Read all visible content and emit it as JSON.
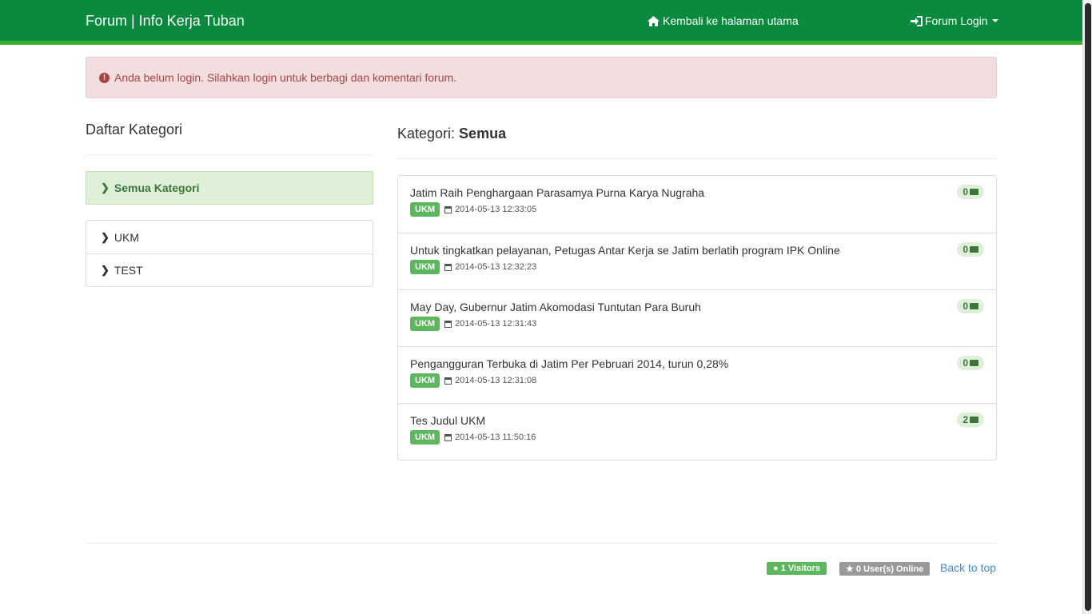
{
  "navbar": {
    "brand": "Forum | Info Kerja Tuban",
    "home_label": "Kembali ke halaman utama",
    "login_label": "Forum Login"
  },
  "alert": {
    "message": "Anda belum login. Silahkan login untuk berbagi dan komentari forum."
  },
  "sidebar": {
    "title": "Daftar Kategori",
    "active": "Semua Kategori",
    "items": [
      {
        "label": "UKM"
      },
      {
        "label": "TEST"
      }
    ]
  },
  "main": {
    "title_prefix": "Kategori: ",
    "title_value": "Semua",
    "topics": [
      {
        "title": "Jatim Raih Penghargaan Parasamya Purna Karya Nugraha",
        "category": "UKM",
        "date": "2014-05-13 12:33:05",
        "comments": "0"
      },
      {
        "title": "Untuk tingkatkan pelayanan, Petugas Antar Kerja se Jatim berlatih program IPK Online",
        "category": "UKM",
        "date": "2014-05-13 12:32:23",
        "comments": "0"
      },
      {
        "title": "May Day, Gubernur Jatim Akomodasi Tuntutan Para Buruh",
        "category": "UKM",
        "date": "2014-05-13 12:31:43",
        "comments": "0"
      },
      {
        "title": "Pengangguran Terbuka di Jatim Per Pebruari 2014, turun 0,28%",
        "category": "UKM",
        "date": "2014-05-13 12:31:08",
        "comments": "0"
      },
      {
        "title": "Tes Judul UKM",
        "category": "UKM",
        "date": "2014-05-13 11:50:16",
        "comments": "2"
      }
    ]
  },
  "footer": {
    "visitors": "1 Visitors",
    "online": "0 User(s) Online",
    "back_to_top": "Back to top"
  },
  "colors": {
    "navbar": "#0a8a3f",
    "accent": "#5cb85c",
    "alert_bg": "#f2dede"
  }
}
